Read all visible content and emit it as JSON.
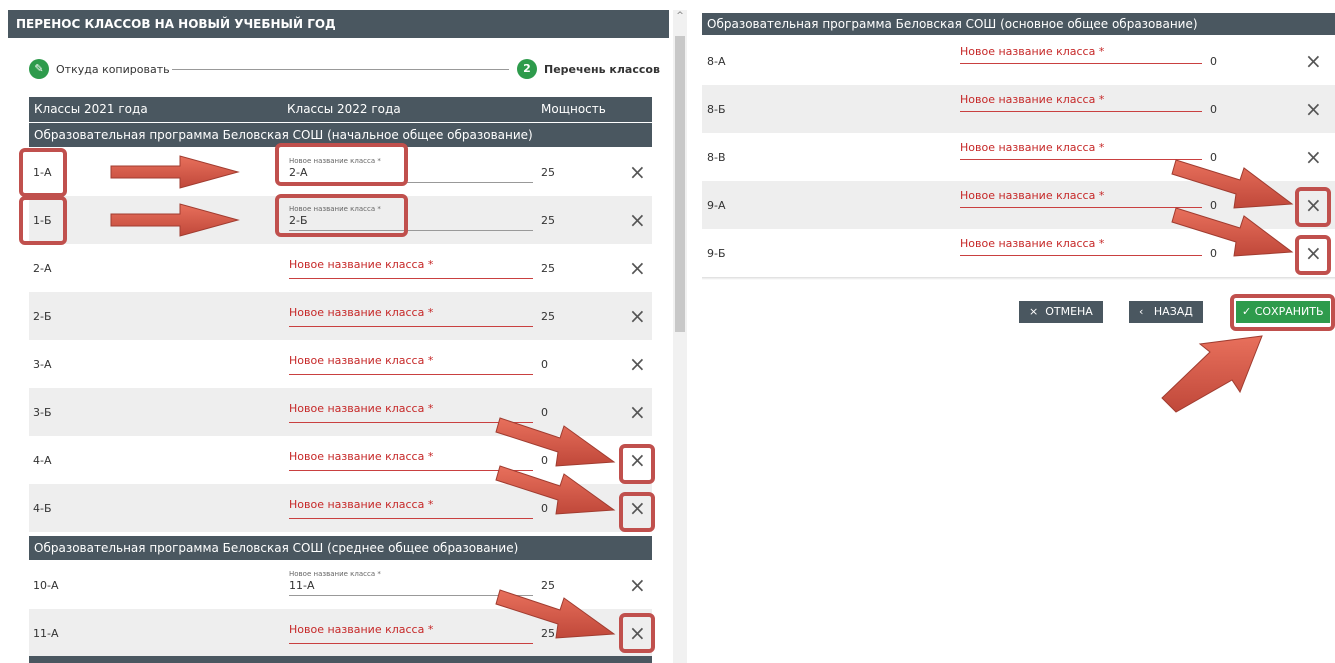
{
  "left_panel": {
    "header": "ПЕРЕНОС КЛАССОВ НА НОВЫЙ УЧЕБНЫЙ ГОД",
    "steps": [
      {
        "label": "Откуда копировать",
        "marker": "✓"
      },
      {
        "label": "Перечень классов",
        "marker": "2"
      }
    ],
    "columns": [
      "Классы 2021 года",
      "Классы 2022 года",
      "Мощность"
    ],
    "groups": [
      {
        "title": "Образовательная программа Беловская СОШ (начальное общее образование)",
        "rows": [
          {
            "from": "1-А",
            "to_label": "Новое название класса *",
            "to_value": "2-А",
            "capacity": "25"
          },
          {
            "from": "1-Б",
            "to_label": "Новое название класса *",
            "to_value": "2-Б",
            "capacity": "25"
          },
          {
            "from": "2-А",
            "placeholder": "Новое название класса *",
            "capacity": "25"
          },
          {
            "from": "2-Б",
            "placeholder": "Новое название класса *",
            "capacity": "25"
          },
          {
            "from": "3-А",
            "placeholder": "Новое название класса *",
            "capacity": "0"
          },
          {
            "from": "3-Б",
            "placeholder": "Новое название класса *",
            "capacity": "0"
          },
          {
            "from": "4-А",
            "placeholder": "Новое название класса *",
            "capacity": "0"
          },
          {
            "from": "4-Б",
            "placeholder": "Новое название класса *",
            "capacity": "0"
          }
        ]
      },
      {
        "title": "Образовательная программа Беловская СОШ (среднее общее образование)",
        "rows": [
          {
            "from": "10-А",
            "to_label": "Новое название класса *",
            "to_value": "11-А",
            "capacity": "25"
          },
          {
            "from": "11-А",
            "placeholder": "Новое название класса *",
            "capacity": "25"
          }
        ]
      }
    ]
  },
  "right_panel": {
    "group_title": "Образовательная программа Беловская СОШ (основное общее образование)",
    "rows": [
      {
        "from": "8-А",
        "placeholder": "Новое название класса *",
        "capacity": "0"
      },
      {
        "from": "8-Б",
        "placeholder": "Новое название класса *",
        "capacity": "0"
      },
      {
        "from": "8-В",
        "placeholder": "Новое название класса *",
        "capacity": "0"
      },
      {
        "from": "9-А",
        "placeholder": "Новое название класса *",
        "capacity": "0"
      },
      {
        "from": "9-Б",
        "placeholder": "Новое название класса *",
        "capacity": "0"
      }
    ],
    "buttons": {
      "cancel": "ОТМЕНА",
      "back": "НАЗАД",
      "save": "СОХРАНИТЬ"
    }
  },
  "icons": {
    "remove": "×",
    "cancel": "×",
    "back": "‹",
    "save": "✓",
    "edit": "✎",
    "scroll_up": "^"
  },
  "colors": {
    "header_bg": "#4a5760",
    "accent_green": "#2e9b4c",
    "required_red": "#c62828",
    "highlight": "#c0504d"
  }
}
